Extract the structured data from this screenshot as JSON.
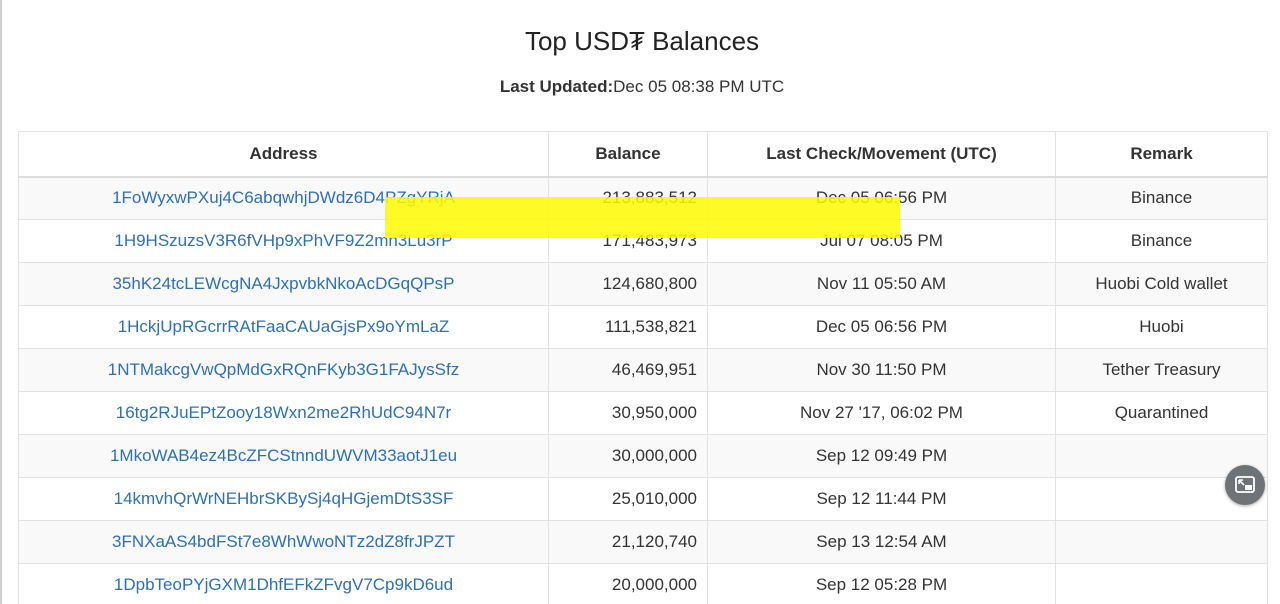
{
  "header": {
    "title": "Top USD₮ Balances",
    "updated_label": "Last Updated:",
    "updated_value": "Dec 05 08:38 PM UTC"
  },
  "table": {
    "columns": [
      "Address",
      "Balance",
      "Last Check/Movement (UTC)",
      "Remark"
    ],
    "rows": [
      {
        "address": "1FoWyxwPXuj4C6abqwhjDWdz6D4PZgYRjA",
        "balance": "213,883,512",
        "date": "Dec 05 06:56 PM",
        "remark": "Binance"
      },
      {
        "address": "1H9HSzuzsV3R6fVHp9xPhVF9Z2mn3Lu3rP",
        "balance": "171,483,973",
        "date": "Jul 07 08:05 PM",
        "remark": "Binance"
      },
      {
        "address": "35hK24tcLEWcgNA4JxpvbkNkoAcDGqQPsP",
        "balance": "124,680,800",
        "date": "Nov 11 05:50 AM",
        "remark": "Huobi Cold wallet"
      },
      {
        "address": "1HckjUpRGcrrRAtFaaCAUaGjsPx9oYmLaZ",
        "balance": "111,538,821",
        "date": "Dec 05 06:56 PM",
        "remark": "Huobi"
      },
      {
        "address": "1NTMakcgVwQpMdGxRQnFKyb3G1FAJysSfz",
        "balance": "46,469,951",
        "date": "Nov 30 11:50 PM",
        "remark": "Tether Treasury"
      },
      {
        "address": "16tg2RJuEPtZooy18Wxn2me2RhUdC94N7r",
        "balance": "30,950,000",
        "date": "Nov 27 '17, 06:02 PM",
        "remark": "Quarantined"
      },
      {
        "address": "1MkoWAB4ez4BcZFCStnndUWVM33aotJ1eu",
        "balance": "30,000,000",
        "date": "Sep 12 09:49 PM",
        "remark": ""
      },
      {
        "address": "14kmvhQrWrNEHbrSKBySj4qHGjemDtS3SF",
        "balance": "25,010,000",
        "date": "Sep 12 11:44 PM",
        "remark": ""
      },
      {
        "address": "3FNXaAS4bdFSt7e8WhWwoNTz2dZ8frJPZT",
        "balance": "21,120,740",
        "date": "Sep 13 12:54 AM",
        "remark": ""
      },
      {
        "address": "1DpbTeoPYjGXM1DhfEFkZFvgV7Cp9kD6ud",
        "balance": "20,000,000",
        "date": "Sep 12 05:28 PM",
        "remark": ""
      }
    ]
  },
  "colors": {
    "link": "#2f70b0",
    "highlight": "#fffa00",
    "float_button": "#6f7377"
  },
  "icons": {
    "float_button": "picture-in-picture-exit-icon"
  }
}
